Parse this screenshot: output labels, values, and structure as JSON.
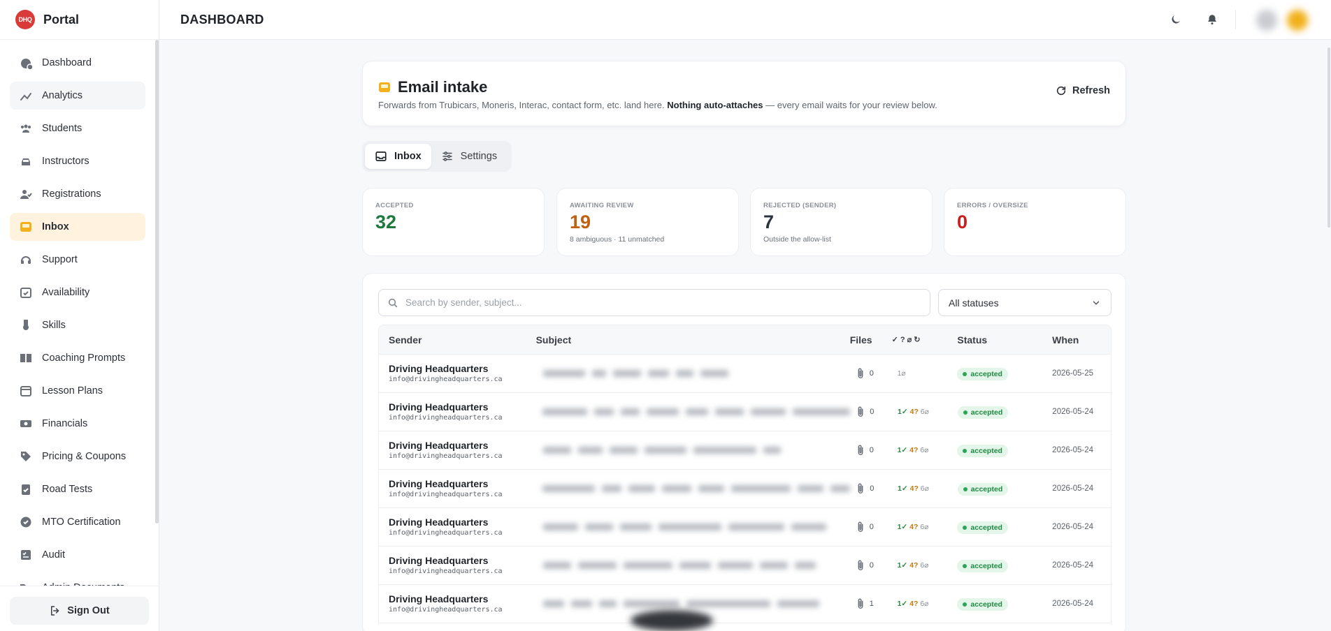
{
  "sidebar": {
    "brand": {
      "logo_text": "DHQ",
      "name": "Portal"
    },
    "items": [
      {
        "label": "Dashboard",
        "icon": "dashboard-icon",
        "state": "normal"
      },
      {
        "label": "Analytics",
        "icon": "analytics-icon",
        "state": "hover"
      },
      {
        "label": "Students",
        "icon": "students-icon",
        "state": "normal"
      },
      {
        "label": "Instructors",
        "icon": "car-icon",
        "state": "normal"
      },
      {
        "label": "Registrations",
        "icon": "user-check-icon",
        "state": "normal"
      },
      {
        "label": "Inbox",
        "icon": "inbox-icon",
        "state": "active"
      },
      {
        "label": "Support",
        "icon": "headset-icon",
        "state": "normal"
      },
      {
        "label": "Availability",
        "icon": "calendar-check-icon",
        "state": "normal"
      },
      {
        "label": "Skills",
        "icon": "medal-icon",
        "state": "normal"
      },
      {
        "label": "Coaching Prompts",
        "icon": "book-icon",
        "state": "normal"
      },
      {
        "label": "Lesson Plans",
        "icon": "calendar-icon",
        "state": "normal"
      },
      {
        "label": "Financials",
        "icon": "money-icon",
        "state": "normal"
      },
      {
        "label": "Pricing & Coupons",
        "icon": "tag-icon",
        "state": "normal"
      },
      {
        "label": "Road Tests",
        "icon": "clipboard-check-icon",
        "state": "normal"
      },
      {
        "label": "MTO Certification",
        "icon": "badge-check-icon",
        "state": "normal"
      },
      {
        "label": "Audit",
        "icon": "checklist-icon",
        "state": "normal"
      },
      {
        "label": "Admin Documents",
        "icon": "folder-icon",
        "state": "normal"
      }
    ],
    "signout_label": "Sign Out"
  },
  "header": {
    "title": "DASHBOARD"
  },
  "intake": {
    "title": "Email intake",
    "desc_prefix": "Forwards from Trubicars, Moneris, Interac, contact form, etc. land here. ",
    "desc_bold": "Nothing auto-attaches",
    "desc_suffix": " — every email waits for your review below.",
    "refresh_label": "Refresh"
  },
  "tabs": [
    {
      "label": "Inbox",
      "active": true
    },
    {
      "label": "Settings",
      "active": false
    }
  ],
  "stats": [
    {
      "label": "ACCEPTED",
      "value": "32",
      "sub": "",
      "color": "#1e7a3c"
    },
    {
      "label": "AWAITING REVIEW",
      "value": "19",
      "sub": "8 ambiguous · 11 unmatched",
      "color": "#c0610f"
    },
    {
      "label": "REJECTED (SENDER)",
      "value": "7",
      "sub": "Outside the allow-list",
      "color": "#2b3340"
    },
    {
      "label": "ERRORS / OVERSIZE",
      "value": "0",
      "sub": "",
      "color": "#c81e1e"
    }
  ],
  "search": {
    "placeholder": "Search by sender, subject..."
  },
  "status_filter": {
    "selected": "All statuses"
  },
  "table": {
    "headers": {
      "sender": "Sender",
      "subject": "Subject",
      "files": "Files",
      "flags": "✓ ? ⌀ ↻",
      "status": "Status",
      "when": "When"
    },
    "rows": [
      {
        "sender": "Driving Headquarters",
        "email": "info@drivingheadquarters.ca",
        "files": "0",
        "ok": "",
        "amb": "",
        "other": "1⌀",
        "status": "accepted",
        "when": "2026-05-25"
      },
      {
        "sender": "Driving Headquarters",
        "email": "info@drivingheadquarters.ca",
        "files": "0",
        "ok": "1✓",
        "amb": "4?",
        "other": "6⌀",
        "status": "accepted",
        "when": "2026-05-24"
      },
      {
        "sender": "Driving Headquarters",
        "email": "info@drivingheadquarters.ca",
        "files": "0",
        "ok": "1✓",
        "amb": "4?",
        "other": "6⌀",
        "status": "accepted",
        "when": "2026-05-24"
      },
      {
        "sender": "Driving Headquarters",
        "email": "info@drivingheadquarters.ca",
        "files": "0",
        "ok": "1✓",
        "amb": "4?",
        "other": "6⌀",
        "status": "accepted",
        "when": "2026-05-24"
      },
      {
        "sender": "Driving Headquarters",
        "email": "info@drivingheadquarters.ca",
        "files": "0",
        "ok": "1✓",
        "amb": "4?",
        "other": "6⌀",
        "status": "accepted",
        "when": "2026-05-24"
      },
      {
        "sender": "Driving Headquarters",
        "email": "info@drivingheadquarters.ca",
        "files": "0",
        "ok": "1✓",
        "amb": "4?",
        "other": "6⌀",
        "status": "accepted",
        "when": "2026-05-24"
      },
      {
        "sender": "Driving Headquarters",
        "email": "info@drivingheadquarters.ca",
        "files": "1",
        "ok": "1✓",
        "amb": "4?",
        "other": "6⌀",
        "status": "accepted",
        "when": "2026-05-24"
      }
    ]
  },
  "colors": {
    "accent": "#f5b01f",
    "active_bg": "#fff3e0",
    "accepted": "#1f8a44",
    "awaiting": "#c0610f",
    "errors": "#c81e1e"
  }
}
